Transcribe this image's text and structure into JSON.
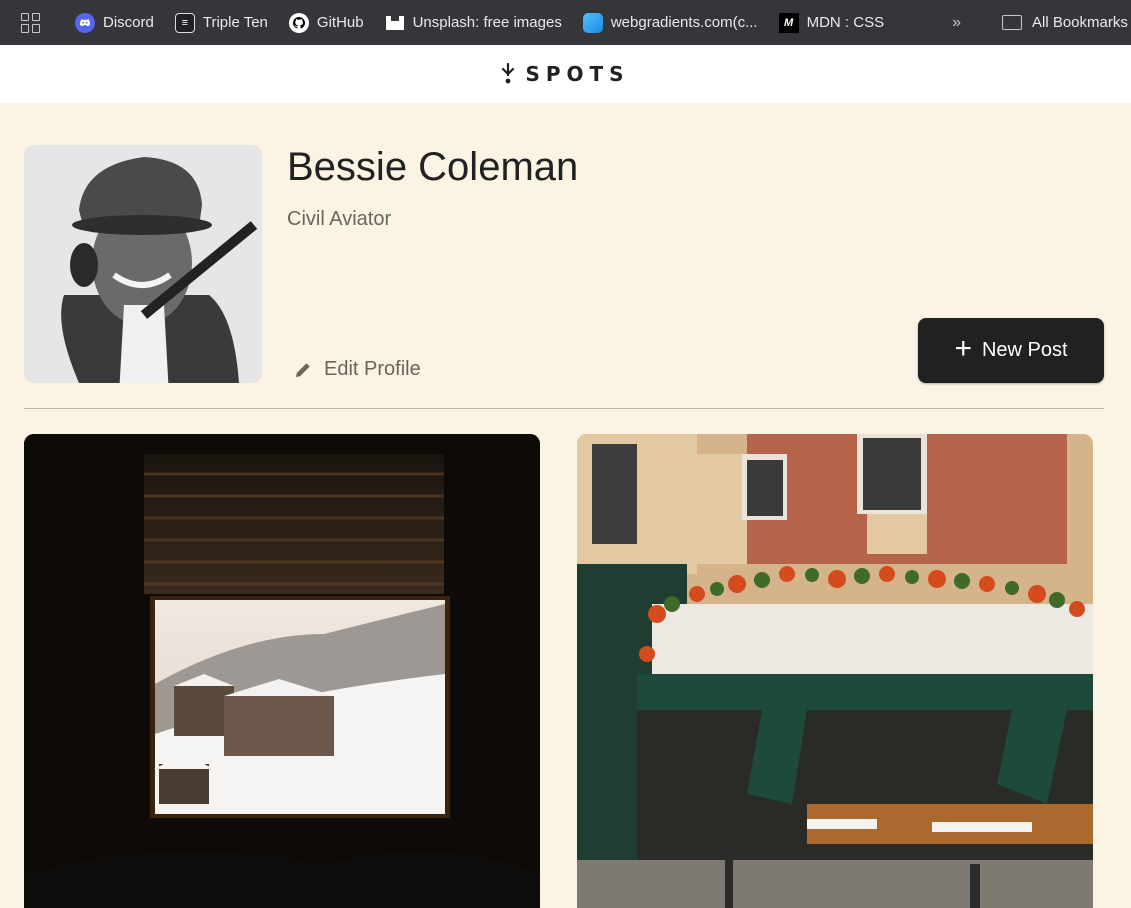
{
  "bookmarks": {
    "items": [
      {
        "label": "Discord",
        "icon": "discord-icon"
      },
      {
        "label": "Triple Ten",
        "icon": "tripleten-icon"
      },
      {
        "label": "GitHub",
        "icon": "github-icon"
      },
      {
        "label": "Unsplash: free images",
        "icon": "unsplash-icon"
      },
      {
        "label": "webgradients.com(c...",
        "icon": "webgradients-icon"
      },
      {
        "label": "MDN : CSS",
        "icon": "mdn-icon"
      }
    ],
    "more": "»",
    "folder": "All Bookmarks"
  },
  "header": {
    "logo_text": "SPOTS"
  },
  "profile": {
    "name": "Bessie Coleman",
    "description": "Civil Aviator",
    "edit_label": "Edit Profile",
    "new_post_label": "New Post",
    "new_post_plus": "+"
  },
  "colors": {
    "background": "#fbf3e4",
    "primary_button": "#212121",
    "secondary_text": "#6b6458"
  },
  "cards": [
    {
      "image": "window-snowy-mountain-image"
    },
    {
      "image": "paris-restaurant-facade-image"
    }
  ]
}
